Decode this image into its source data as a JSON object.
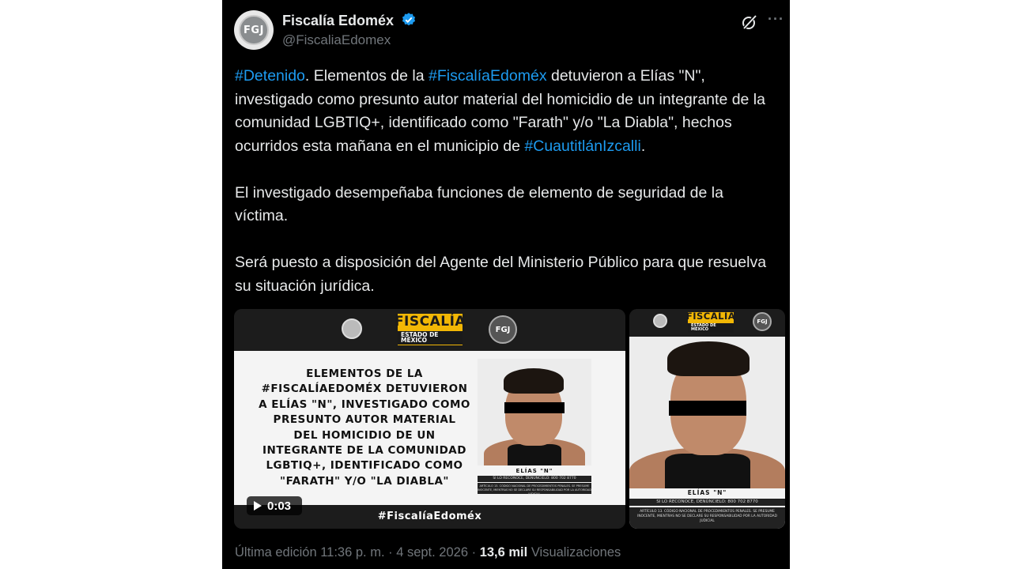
{
  "author": {
    "name": "Fiscalía Edoméx",
    "handle": "@FiscaliaEdomex",
    "avatar_text": "FGJ"
  },
  "post": {
    "p1_tag1": "#Detenido",
    "p1_t1": ". Elementos de la ",
    "p1_tag2": "#FiscalíaEdoméx",
    "p1_t2": " detuvieron a Elías \"N\", investigado como presunto autor material del homicidio de un integrante de la comunidad LGBTIQ+, identificado como \"Farath\" y/o \"La Diabla\", hechos ocurridos esta mañana en el municipio de ",
    "p1_tag3": "#CuautitlánIzcalli",
    "p1_t3": ".",
    "p2": "El investigado desempeñaba funciones de elemento de seguridad de la víctima.",
    "p3": "Será puesto a disposición del Agente del Ministerio Público para que resuelva su situación jurídica."
  },
  "media": {
    "brand_title": "FISCALÍA",
    "brand_sub": "ESTADO DE MÉXICO",
    "badge": "FGJ",
    "headline_lines": [
      "ELEMENTOS DE LA",
      "#FISCALÍAEDOMÉX DETUVIERON",
      "A ELÍAS \"N\", INVESTIGADO COMO",
      "PRESUNTO AUTOR MATERIAL",
      "DEL HOMICIDIO DE UN",
      "INTEGRANTE DE LA COMUNIDAD",
      "LGBTIQ+, IDENTIFICADO COMO",
      "\"FARATH\" Y/O \"LA DIABLA\""
    ],
    "mug_name": "ELÍAS \"N\"",
    "mug_notice": "SI LO RECONOCE, DENÚNCIELO: 800 702 8770",
    "mug_legal": "ARTÍCULO 13. CÓDIGO NACIONAL DE PROCEDIMIENTOS PENALES. SE PRESUME INOCENTE, MIENTRAS NO SE DECLARE SU RESPONSABILIDAD POR LA AUTORIDAD JUDICIAL",
    "footer_tag": "#FiscalíaEdoméx",
    "video_duration": "0:03"
  },
  "meta": {
    "edited": "Última edición 11:36 p. m. · 4 sept. 2026 · ",
    "views_count": "13,6 mil",
    "views_label": " Visualizaciones"
  },
  "colors": {
    "background": "#000000",
    "text": "#e7e9ea",
    "link": "#1d9bf0",
    "muted": "#71767b",
    "verified": "#1d9bf0",
    "brand_yellow": "#f2b705"
  },
  "icons": [
    "verified-badge-icon",
    "grok-icon",
    "more-icon",
    "play-icon"
  ]
}
